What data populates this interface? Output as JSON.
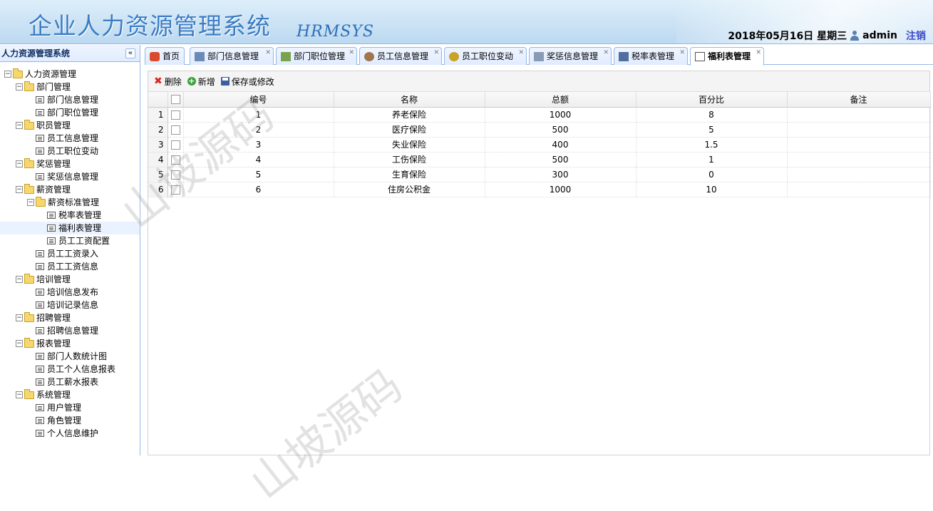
{
  "header": {
    "title": "企业人力资源管理系统",
    "subtitle": "HRMSYS",
    "datetime": "2018年05月16日 星期三",
    "username": "admin",
    "logout": "注销"
  },
  "sidebar": {
    "title": "人力资源管理系统",
    "collapse": "«",
    "tree": [
      {
        "label": "人力资源管理",
        "level": 0,
        "type": "folder"
      },
      {
        "label": "部门管理",
        "level": 1,
        "type": "folder"
      },
      {
        "label": "部门信息管理",
        "level": 2,
        "type": "file"
      },
      {
        "label": "部门职位管理",
        "level": 2,
        "type": "file"
      },
      {
        "label": "职员管理",
        "level": 1,
        "type": "folder"
      },
      {
        "label": "员工信息管理",
        "level": 2,
        "type": "file"
      },
      {
        "label": "员工职位变动",
        "level": 2,
        "type": "file"
      },
      {
        "label": "奖惩管理",
        "level": 1,
        "type": "folder"
      },
      {
        "label": "奖惩信息管理",
        "level": 2,
        "type": "file"
      },
      {
        "label": "薪资管理",
        "level": 1,
        "type": "folder"
      },
      {
        "label": "薪资标准管理",
        "level": 2,
        "type": "folder"
      },
      {
        "label": "税率表管理",
        "level": 3,
        "type": "file"
      },
      {
        "label": "福利表管理",
        "level": 3,
        "type": "file",
        "selected": true
      },
      {
        "label": "员工工资配置",
        "level": 3,
        "type": "file"
      },
      {
        "label": "员工工资录入",
        "level": 2,
        "type": "file"
      },
      {
        "label": "员工工资信息",
        "level": 2,
        "type": "file"
      },
      {
        "label": "培训管理",
        "level": 1,
        "type": "folder"
      },
      {
        "label": "培训信息发布",
        "level": 2,
        "type": "file"
      },
      {
        "label": "培训记录信息",
        "level": 2,
        "type": "file"
      },
      {
        "label": "招聘管理",
        "level": 1,
        "type": "folder"
      },
      {
        "label": "招聘信息管理",
        "level": 2,
        "type": "file"
      },
      {
        "label": "报表管理",
        "level": 1,
        "type": "folder"
      },
      {
        "label": "部门人数统计图",
        "level": 2,
        "type": "file"
      },
      {
        "label": "员工个人信息报表",
        "level": 2,
        "type": "file"
      },
      {
        "label": "员工薪水报表",
        "level": 2,
        "type": "file"
      },
      {
        "label": "系统管理",
        "level": 1,
        "type": "folder"
      },
      {
        "label": "用户管理",
        "level": 2,
        "type": "file"
      },
      {
        "label": "角色管理",
        "level": 2,
        "type": "file"
      },
      {
        "label": "个人信息维护",
        "level": 2,
        "type": "file"
      }
    ]
  },
  "tabs": [
    {
      "label": "首页",
      "icon": "home-icon",
      "closable": false
    },
    {
      "label": "部门信息管理",
      "icon": "department-icon",
      "closable": true
    },
    {
      "label": "部门职位管理",
      "icon": "position-icon",
      "closable": true
    },
    {
      "label": "员工信息管理",
      "icon": "employee-icon",
      "closable": true
    },
    {
      "label": "员工职位变动",
      "icon": "transfer-icon",
      "closable": true
    },
    {
      "label": "奖惩信息管理",
      "icon": "reward-icon",
      "closable": true
    },
    {
      "label": "税率表管理",
      "icon": "tax-table-icon",
      "closable": true
    },
    {
      "label": "福利表管理",
      "icon": "welfare-icon",
      "closable": true,
      "active": true
    }
  ],
  "toolbar": {
    "delete": "删除",
    "add": "新增",
    "save": "保存或修改"
  },
  "grid": {
    "columns": [
      "编号",
      "名称",
      "总额",
      "百分比",
      "备注"
    ],
    "rows": [
      {
        "n": "1",
        "id": "1",
        "name": "养老保险",
        "total": "1000",
        "percent": "8",
        "remark": ""
      },
      {
        "n": "2",
        "id": "2",
        "name": "医疗保险",
        "total": "500",
        "percent": "5",
        "remark": ""
      },
      {
        "n": "3",
        "id": "3",
        "name": "失业保险",
        "total": "400",
        "percent": "1.5",
        "remark": ""
      },
      {
        "n": "4",
        "id": "4",
        "name": "工伤保险",
        "total": "500",
        "percent": "1",
        "remark": ""
      },
      {
        "n": "5",
        "id": "5",
        "name": "生育保险",
        "total": "300",
        "percent": "0",
        "remark": ""
      },
      {
        "n": "6",
        "id": "6",
        "name": "住房公积金",
        "total": "1000",
        "percent": "10",
        "remark": ""
      }
    ]
  },
  "watermark": "山坡源码"
}
